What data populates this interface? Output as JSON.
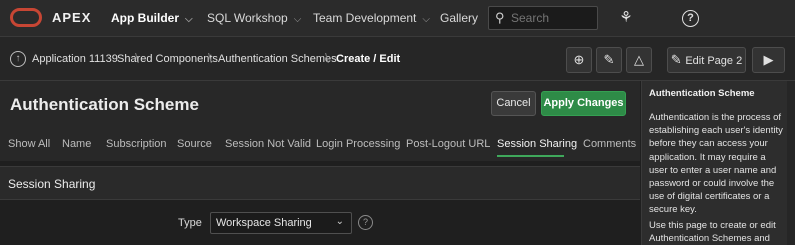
{
  "brand": {
    "name": "APEX"
  },
  "topnav": {
    "items": [
      {
        "label": "App Builder",
        "caret": "⌵"
      },
      {
        "label": "SQL Workshop",
        "caret": "⌵"
      },
      {
        "label": "Team Development",
        "caret": "⌵"
      },
      {
        "label": "Gallery"
      }
    ],
    "search_placeholder": "Search"
  },
  "breadcrumb": {
    "items": [
      "Application 11139",
      "Shared Components",
      "Authentication Schemes"
    ],
    "current": "Create / Edit"
  },
  "toolbar": {
    "edit_page_label": "Edit Page 2"
  },
  "page": {
    "title": "Authentication Scheme",
    "cancel_label": "Cancel",
    "apply_label": "Apply Changes"
  },
  "tabs": [
    "Show All",
    "Name",
    "Subscription",
    "Source",
    "Session Not Valid",
    "Login Processing",
    "Post-Logout URL",
    "Session Sharing",
    "Comments"
  ],
  "active_tab": "Session Sharing",
  "section": {
    "title": "Session Sharing",
    "type_label": "Type",
    "type_value": "Workspace Sharing"
  },
  "help": {
    "title": "Authentication Scheme",
    "lines_p1": [
      "Authentication is the process of",
      "establishing each user's identity",
      "before they can access your",
      "application. It may require a",
      "user to enter a user name and",
      "password or could involve the",
      "use of digital certificates or a",
      "secure key."
    ],
    "lines_p2": [
      "Use this page to create or edit",
      "Authentication Schemes and"
    ]
  },
  "colors": {
    "accent_green": "#2e8b47",
    "oracle_red": "#c74634",
    "tab_underline": "#3fa85b"
  }
}
